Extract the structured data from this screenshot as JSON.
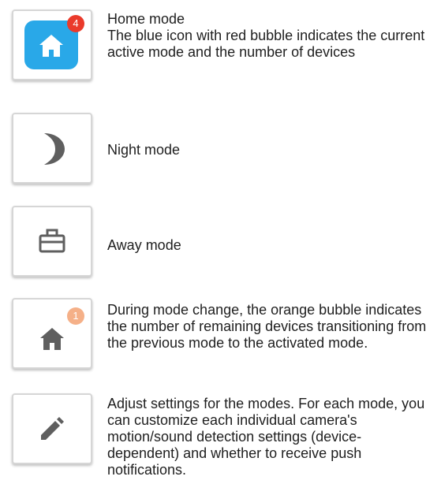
{
  "colors": {
    "active_blue": "#29a8e8",
    "badge_red": "#ea3a2b",
    "badge_orange": "#f5b088",
    "icon_gray": "#5f5f5f"
  },
  "modes": [
    {
      "icon": "home-icon",
      "active": true,
      "badge": "4",
      "title": "Home mode",
      "description": "The blue icon with red bubble indicates the current active mode and the number of devices"
    },
    {
      "icon": "moon-icon",
      "title": "Night mode"
    },
    {
      "icon": "briefcase-icon",
      "title": "Away mode"
    },
    {
      "icon": "home-icon",
      "badge": "1",
      "description": "During mode change, the orange bubble indicates the number of remaining devices transitioning from the previous mode to the activated mode."
    },
    {
      "icon": "pencil-icon",
      "description": "Adjust settings for the modes. For each mode, you can customize each individual camera's motion/sound detection settings (device-dependent) and whether to receive push notifications."
    }
  ]
}
